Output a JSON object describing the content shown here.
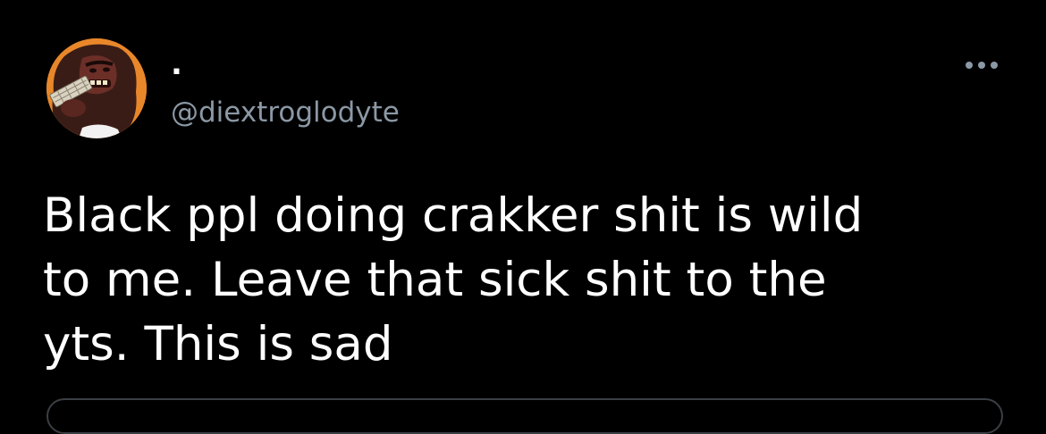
{
  "tweet": {
    "author": {
      "display_name": ".",
      "handle": "@diextroglodyte",
      "avatar_icon": "caveman-avatar-icon"
    },
    "text": "Black ppl doing crakker shit is wild\nto me. Leave that sick shit to the\nyts. This is sad",
    "more_icon": "more-horizontal-icon"
  },
  "colors": {
    "background": "#000000",
    "text_primary": "#ffffff",
    "text_secondary": "#8b98a5",
    "avatar_bg": "#e8872a"
  }
}
